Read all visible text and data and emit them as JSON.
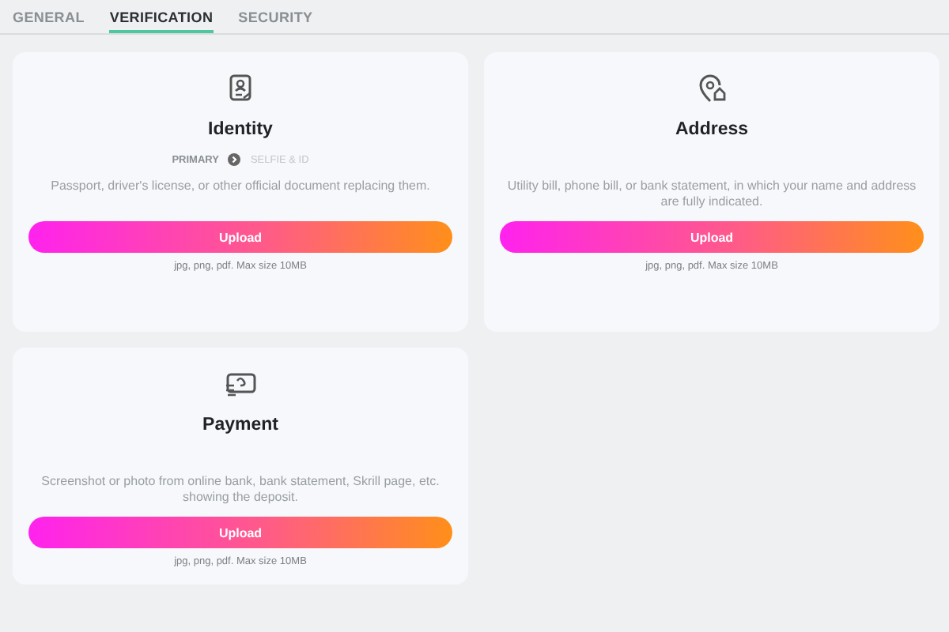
{
  "tabs": [
    {
      "label": "GENERAL",
      "selected": false
    },
    {
      "label": "VERIFICATION",
      "selected": true
    },
    {
      "label": "SECURITY",
      "selected": false
    }
  ],
  "cards": [
    {
      "title": "Identity",
      "steps": [
        {
          "label": "PRIMARY",
          "active": true
        },
        {
          "label": "SELFIE & ID",
          "active": false
        }
      ],
      "description": "Passport, driver's license, or other official document replacing them.",
      "button": "Upload",
      "note": "jpg, png, pdf. Max size 10MB"
    },
    {
      "title": "Address",
      "description": "Utility bill, phone bill, or bank statement, in which your name and address are fully indicated.",
      "button": "Upload",
      "note": "jpg, png, pdf. Max size 10MB"
    },
    {
      "title": "Payment",
      "description": "Screenshot or photo from online bank, bank statement, Skrill page, etc. showing the deposit.",
      "button": "Upload",
      "note": "jpg, png, pdf. Max size 10MB"
    }
  ]
}
